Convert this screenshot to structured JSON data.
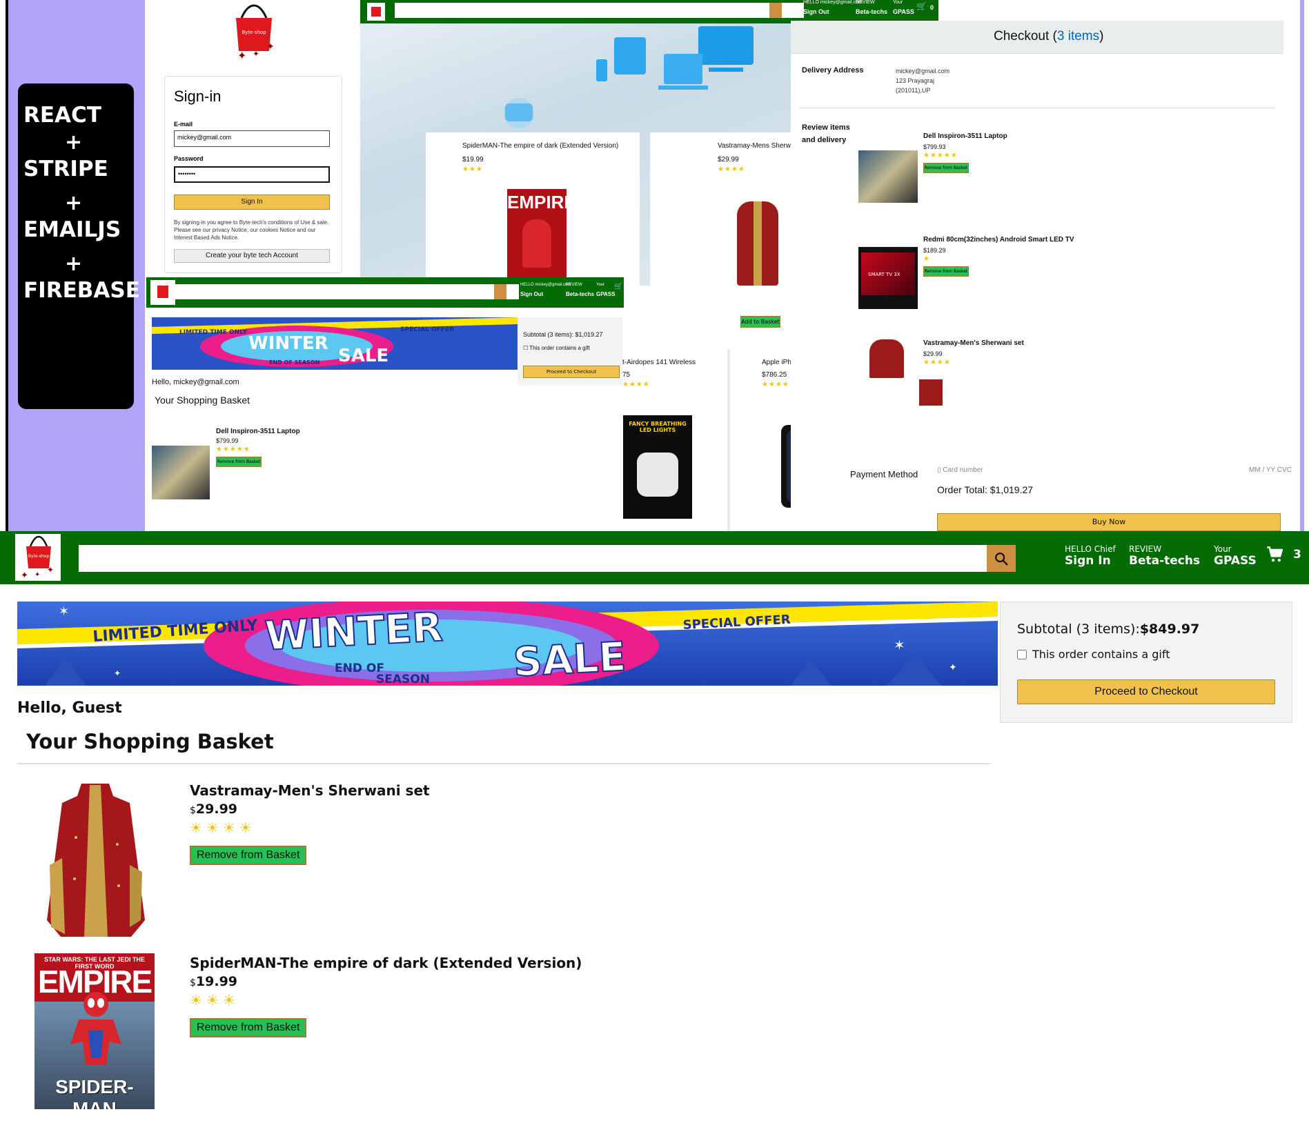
{
  "colors": {
    "header_green": "#046b05",
    "search_button": "#cd9042",
    "checkout_yellow": "#f0c14b",
    "remove_green": "#28bf55",
    "lavender": "#b2a4fb",
    "star": "#f5c400"
  },
  "collage": {
    "stack": [
      "REACT",
      "+",
      "STRIPE",
      "+",
      "EMAILJS",
      "+",
      "FIREBASE"
    ],
    "logo_text": "Byte-shop",
    "signin": {
      "title": "Sign-in",
      "email_label": "E-mail",
      "email_value": "mickey@gmail.com",
      "password_label": "Password",
      "password_value": "••••••••",
      "signin_button": "Sign In",
      "terms": "By signing-in you agree to Byte-tech's conditions of Use & sale. Please see our privacy Notice, our cookies Notice and our Interest Based Ads Notice.",
      "create_button": "Create your byte tech Account"
    },
    "top_header": {
      "line1": [
        "HELLO mickey@gmail.com",
        "REVIEW",
        "Your"
      ],
      "line2": [
        "Sign Out",
        "Beta-techs",
        "GPASS"
      ],
      "count": "0"
    },
    "mid_header": {
      "line1": [
        "HELLO mickey@gmail.com",
        "REVIEW",
        "Your"
      ],
      "line2": [
        "Sign Out",
        "Beta-techs",
        "GPASS"
      ]
    },
    "products": [
      {
        "title": "SpiderMAN-The empire of dark (Extended Version)",
        "price": "$19.99",
        "stars": "★★★"
      },
      {
        "title": "Vastramay-Mens Sherwar",
        "price": "$29.99",
        "stars": "★★★★",
        "button": "Add to Basket"
      },
      {
        "title": "t-Airdopes 141 Wireless",
        "price": "75",
        "stars": "★★★★",
        "image_text": "FANCY BREATHING LED LIGHTS"
      },
      {
        "title": "Apple iPh",
        "price": "$786.25",
        "stars": "★★★★"
      }
    ],
    "mini_basket": {
      "banner_text": {
        "limited": "LIMITED TIME ONLY",
        "winter": "WINTER",
        "sale": "SALE",
        "special": "SPECIAL OFFER",
        "end": "END OF SEASON"
      },
      "hello": "Hello, mickey@gmail.com",
      "title": "Your Shopping Basket",
      "item_title": "Dell Inspiron-3511 Laptop",
      "item_price": "$799.99",
      "item_stars": "★★★★★",
      "remove": "Remove from Basket",
      "subtotal": "Subtotal (3 items): $1,019.27",
      "gift": "This order contains a gift",
      "checkout": "Proceed to Checkout"
    },
    "checkout": {
      "title_prefix": "Checkout (",
      "title_link": "3 items",
      "title_suffix": ")",
      "delivery_label": "Delivery Address",
      "address": [
        "mickey@gmail.com",
        "123 Prayagraj",
        "(201011),UP"
      ],
      "review_label": "Review items and delivery",
      "items": [
        {
          "title": "Dell Inspiron-3511 Laptop",
          "price": "$799.93",
          "stars": "★★★★★",
          "remove": "Remove from Basket"
        },
        {
          "title": "Redmi 80cm(32inches) Android Smart LED TV",
          "price": "$189.29",
          "stars": "★",
          "remove": "Remove from Basket",
          "image_text": "SMART TV 3X"
        },
        {
          "title": "Vastramay-Men's Sherwani set",
          "price": "$29.99",
          "stars": "★★★★"
        }
      ],
      "payment_label": "Payment Method",
      "card_placeholder": "Card number",
      "card_right": "MM / YY CVC",
      "order_total": "Order Total: $1,019.27",
      "buy_now": "Buy Now"
    }
  },
  "header": {
    "logo_alt": "Byte-shop",
    "search_value": "",
    "nav": [
      {
        "line1": "HELLO Chief",
        "line2": "Sign In"
      },
      {
        "line1": "REVIEW",
        "line2": "Beta-techs"
      },
      {
        "line1": "Your",
        "line2": "GPASS"
      }
    ],
    "basket_count": "3"
  },
  "banner": {
    "limited": "LIMITED TIME ONLY",
    "winter": "WINTER",
    "sale": "SALE",
    "special": "SPECIAL OFFER",
    "end1": "END OF",
    "end2": "SEASON"
  },
  "subtotal": {
    "label": "Subtotal (3 items):",
    "amount": "$849.97",
    "gift_label": "This order contains a gift",
    "checkout_button": "Proceed to Checkout"
  },
  "basket": {
    "hello": "Hello, Guest",
    "title": "Your Shopping Basket",
    "items": [
      {
        "title": "Vastramay-Men's Sherwani set",
        "currency": "$",
        "price": "29.99",
        "stars": "☀☀☀☀",
        "rating": 4,
        "remove": "Remove from Basket"
      },
      {
        "title": "SpiderMAN-The empire of dark (Extended Version)",
        "currency": "$",
        "price": "19.99",
        "stars": "☀☀☀",
        "rating": 3,
        "remove": "Remove from Basket",
        "cover": {
          "top_line": "STAR WARS: THE LAST JEDI  THE FIRST WORD",
          "masthead": "EMPIRE",
          "bottom": "SPIDER-MAN"
        }
      }
    ]
  }
}
